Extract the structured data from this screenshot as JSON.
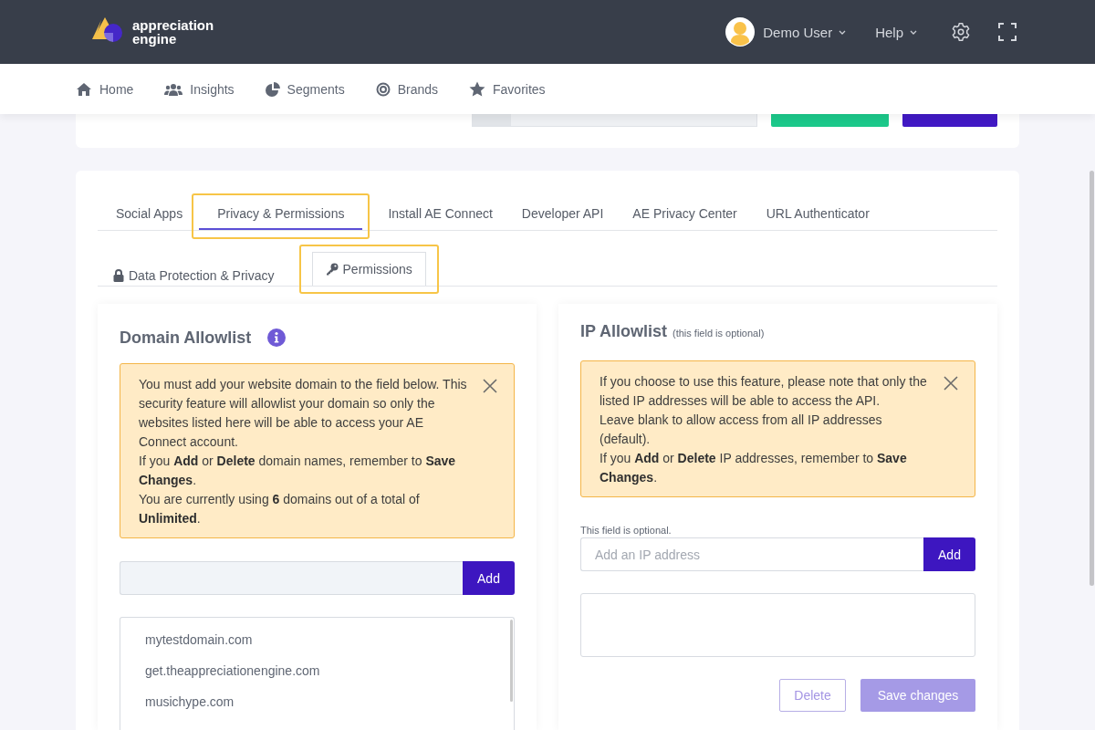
{
  "header": {
    "logo": {
      "line1": "appreciation",
      "line2": "engine"
    },
    "user_menu": {
      "label": "Demo User"
    },
    "help_menu": {
      "label": "Help"
    }
  },
  "nav": [
    {
      "label": "Home"
    },
    {
      "label": "Insights"
    },
    {
      "label": "Segments"
    },
    {
      "label": "Brands"
    },
    {
      "label": "Favorites"
    }
  ],
  "tabs": [
    {
      "label": "Social Apps",
      "selected": false,
      "highlighted": false
    },
    {
      "label": "Privacy & Permissions",
      "selected": true,
      "highlighted": true
    },
    {
      "label": "Install AE Connect",
      "selected": false,
      "highlighted": false
    },
    {
      "label": "Developer API",
      "selected": false,
      "highlighted": false
    },
    {
      "label": "AE Privacy Center",
      "selected": false,
      "highlighted": false
    },
    {
      "label": "URL Authenticator",
      "selected": false,
      "highlighted": false
    }
  ],
  "subtabs": [
    {
      "label": "Data Protection & Privacy",
      "selected": false,
      "highlighted": false
    },
    {
      "label": "Permissions",
      "selected": true,
      "highlighted": true
    }
  ],
  "domain_allowlist": {
    "title": "Domain Allowlist",
    "alert": [
      "You must add your website domain to the field below. This security feature will allowlist your domain so only the websites listed here will be able to access your AE Connect account.",
      "If you **Add** or **Delete** domain names, remember to **Save Changes**.",
      "You are currently using **6** domains out of a total of **Unlimited**."
    ],
    "add_button": "Add",
    "domains": [
      "mytestdomain.com",
      "get.theappreciationengine.com",
      "musichype.com"
    ]
  },
  "ip_allowlist": {
    "title": "IP Allowlist",
    "note": "(this field is optional)",
    "alert": [
      "If you choose to use this feature, please note that only the listed IP addresses will be able to access the API.",
      "Leave blank to allow access from all IP addresses (default).",
      "If you **Add** or **Delete** IP addresses, remember to **Save Changes**."
    ],
    "field_label": "This field is optional.",
    "input": {
      "placeholder": "Add an IP address"
    },
    "add_button": "Add",
    "delete_button": {
      "label": "Delete",
      "disabled": true
    },
    "save_button": {
      "label": "Save changes",
      "disabled": true
    }
  }
}
